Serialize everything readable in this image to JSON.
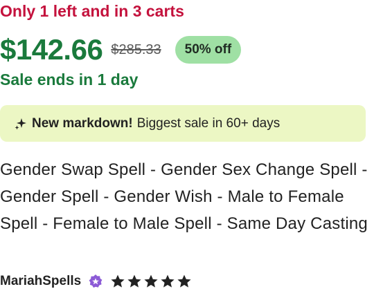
{
  "stock_notice": "Only 1 left and in 3 carts",
  "price": {
    "current": "$142.66",
    "original": "$285.33",
    "discount_badge": "50% off"
  },
  "sale_ends": "Sale ends in 1 day",
  "markdown_banner": {
    "icon": "sparkle-icon",
    "headline": "New markdown!",
    "detail": "Biggest sale in 60+ days"
  },
  "listing_title": "Gender Swap Spell - Gender Sex Change Spell - Gender Spell - Gender Wish - Male to Female Spell - Female to Male Spell - Same Day Casting",
  "seller": {
    "name": "MariahSpells",
    "badge_icon": "star-seller-icon",
    "rating": 5,
    "rating_max": 5
  },
  "colors": {
    "stock": "#c4123d",
    "price": "#1a7a3c",
    "badge_bg": "#9fe0a4",
    "banner_bg": "#ecf7c4",
    "star_seller": "#8c5bd6"
  }
}
